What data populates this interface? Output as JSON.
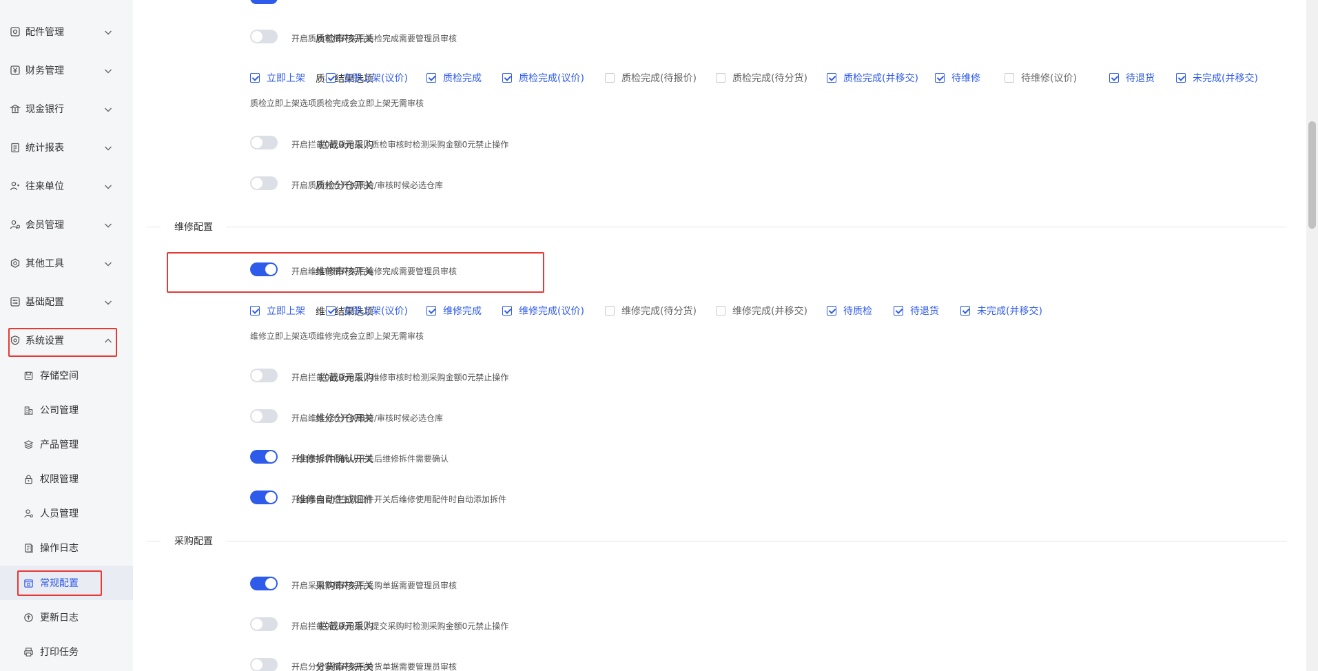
{
  "sidebar": {
    "menus": [
      {
        "label": "配件管理",
        "icon": "parts-icon"
      },
      {
        "label": "财务管理",
        "icon": "yen-icon"
      },
      {
        "label": "现金银行",
        "icon": "bank-icon"
      },
      {
        "label": "统计报表",
        "icon": "report-icon"
      },
      {
        "label": "往来单位",
        "icon": "contacts-icon"
      },
      {
        "label": "会员管理",
        "icon": "member-icon"
      },
      {
        "label": "其他工具",
        "icon": "tools-icon"
      },
      {
        "label": "基础配置",
        "icon": "config-icon"
      },
      {
        "label": "系统设置",
        "icon": "shield-icon"
      }
    ],
    "sub_items": [
      {
        "label": "存储空间",
        "icon": "storage-icon"
      },
      {
        "label": "公司管理",
        "icon": "company-icon"
      },
      {
        "label": "产品管理",
        "icon": "layers-icon"
      },
      {
        "label": "权限管理",
        "icon": "lock-icon"
      },
      {
        "label": "人员管理",
        "icon": "user-icon"
      },
      {
        "label": "操作日志",
        "icon": "log-icon"
      },
      {
        "label": "常规配置",
        "icon": "settings-icon"
      },
      {
        "label": "更新日志",
        "icon": "update-icon"
      },
      {
        "label": "打印任务",
        "icon": "printer-icon"
      }
    ]
  },
  "qc": {
    "audit": {
      "label": "质检审核开关",
      "on": false,
      "desc": "开启质检审核开关后质检完成需要管理员审核"
    },
    "result_label": "质检结果选项",
    "result_options": [
      {
        "text": "立即上架",
        "checked": true
      },
      {
        "text": "立即上架(议价)",
        "checked": true
      },
      {
        "text": "质检完成",
        "checked": true
      },
      {
        "text": "质检完成(议价)",
        "checked": true
      },
      {
        "text": "质检完成(待报价)",
        "checked": false
      },
      {
        "text": "质检完成(待分货)",
        "checked": false
      },
      {
        "text": "质检完成(并移交)",
        "checked": true
      },
      {
        "text": "待维修",
        "checked": true
      },
      {
        "text": "待维修(议价)",
        "checked": false
      },
      {
        "text": "待退货",
        "checked": true
      },
      {
        "text": "未完成(并移交)",
        "checked": true
      }
    ],
    "result_hint": "质检立即上架选项质检完成会立即上架无需审核",
    "block_zero": {
      "label": "拦截0元采购",
      "on": false,
      "desc": "开启拦截0元采购后，质检审核时检测采购金额0元禁止操作"
    },
    "warehouse": {
      "label": "质检分仓开关",
      "on": false,
      "desc": "开启质检分仓开关质检/审核时候必选仓库"
    }
  },
  "repair": {
    "section_title": "维修配置",
    "audit": {
      "label": "维修审核开关",
      "on": true,
      "desc": "开启维修审核开关后维修完成需要管理员审核"
    },
    "result_label": "维修结果选项",
    "result_options": [
      {
        "text": "立即上架",
        "checked": true
      },
      {
        "text": "立即上架(议价)",
        "checked": true
      },
      {
        "text": "维修完成",
        "checked": true
      },
      {
        "text": "维修完成(议价)",
        "checked": true
      },
      {
        "text": "维修完成(待分货)",
        "checked": false
      },
      {
        "text": "维修完成(并移交)",
        "checked": false
      },
      {
        "text": "待质检",
        "checked": true
      },
      {
        "text": "待退货",
        "checked": true
      },
      {
        "text": "未完成(并移交)",
        "checked": true
      }
    ],
    "result_hint": "维修立即上架选项维修完成会立即上架无需审核",
    "block_zero": {
      "label": "拦截0元采购",
      "on": false,
      "desc": "开启拦截0元采购后，维修审核时检测采购金额0元禁止操作"
    },
    "warehouse": {
      "label": "维修分仓开关",
      "on": false,
      "desc": "开启维修分仓开关维修/审核时候必选仓库"
    },
    "dismantle": {
      "label": "维修拆件确认开关",
      "on": true,
      "desc": "开启维修拆件确认开关后维修拆件需要确认"
    },
    "auto_old": {
      "label": "维修自动生成旧件",
      "on": true,
      "desc": "开启维修自动生成旧件开关后维修使用配件时自动添加拆件"
    }
  },
  "purchase": {
    "section_title": "采购配置",
    "audit": {
      "label": "采购审核开关",
      "on": true,
      "desc": "开启采购审核开关后采购单据需要管理员审核"
    },
    "block_zero": {
      "label": "拦截0元采购",
      "on": false,
      "desc": "开启拦截0元采购后，提交采购时检测采购金额0元禁止操作"
    },
    "split": {
      "label": "分货审核开关",
      "on": false,
      "desc": "开启分货审核开关后分货单据需要管理员审核"
    }
  },
  "colors": {
    "accent": "#2f5bea",
    "highlight": "#e53935"
  }
}
